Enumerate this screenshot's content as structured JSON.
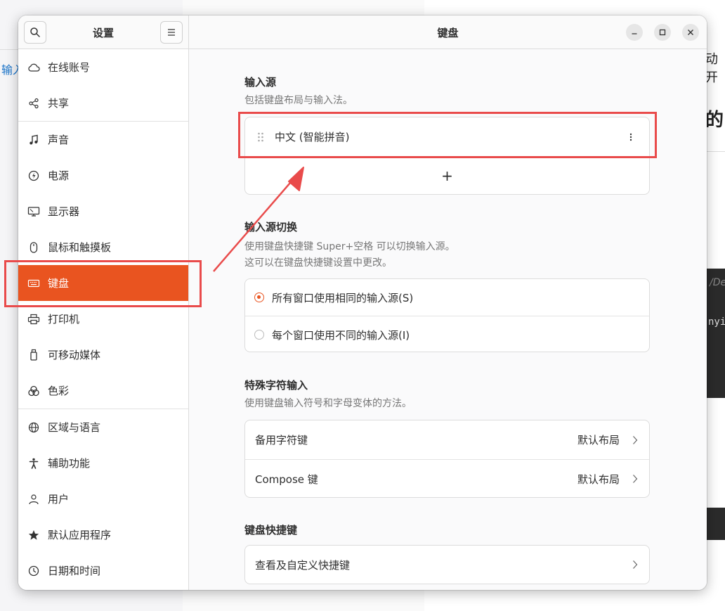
{
  "background": {
    "left_text": "输入",
    "right_text_1": "动开",
    "right_text_2": "的",
    "code_text_1": "/De",
    "code_text_2": "nyi"
  },
  "sidebar": {
    "title": "设置",
    "items": [
      {
        "label": "在线账号",
        "icon": "cloud-icon"
      },
      {
        "label": "共享",
        "icon": "share-icon"
      },
      {
        "label": "声音",
        "icon": "music-note-icon"
      },
      {
        "label": "电源",
        "icon": "power-icon"
      },
      {
        "label": "显示器",
        "icon": "monitor-icon"
      },
      {
        "label": "鼠标和触摸板",
        "icon": "mouse-icon"
      },
      {
        "label": "键盘",
        "icon": "keyboard-icon"
      },
      {
        "label": "打印机",
        "icon": "printer-icon"
      },
      {
        "label": "可移动媒体",
        "icon": "removable-media-icon"
      },
      {
        "label": "色彩",
        "icon": "color-icon"
      },
      {
        "label": "区域与语言",
        "icon": "globe-icon"
      },
      {
        "label": "辅助功能",
        "icon": "accessibility-icon"
      },
      {
        "label": "用户",
        "icon": "user-icon"
      },
      {
        "label": "默认应用程序",
        "icon": "star-icon"
      },
      {
        "label": "日期和时间",
        "icon": "clock-icon"
      }
    ],
    "active_index": 6
  },
  "main": {
    "title": "键盘",
    "input_sources": {
      "title": "输入源",
      "description": "包括键盘布局与输入法。",
      "source": "中文 (智能拼音)",
      "add_label": "+"
    },
    "switching": {
      "title": "输入源切换",
      "description_line1": "使用键盘快捷键 Super+空格 可以切换输入源。",
      "description_line2": "这可以在键盘快捷键设置中更改。",
      "option_same": "所有窗口使用相同的输入源(S)",
      "option_different": "每个窗口使用不同的输入源(I)",
      "selected": "option_same"
    },
    "special_chars": {
      "title": "特殊字符输入",
      "description": "使用键盘输入符号和字母变体的方法。",
      "alternate_label": "备用字符键",
      "alternate_value": "默认布局",
      "compose_label": "Compose 键",
      "compose_value": "默认布局"
    },
    "shortcuts": {
      "title": "键盘快捷键",
      "view_label": "查看及自定义快捷键"
    }
  },
  "colors": {
    "accent": "#e95420",
    "annotation": "#e94b4b"
  }
}
